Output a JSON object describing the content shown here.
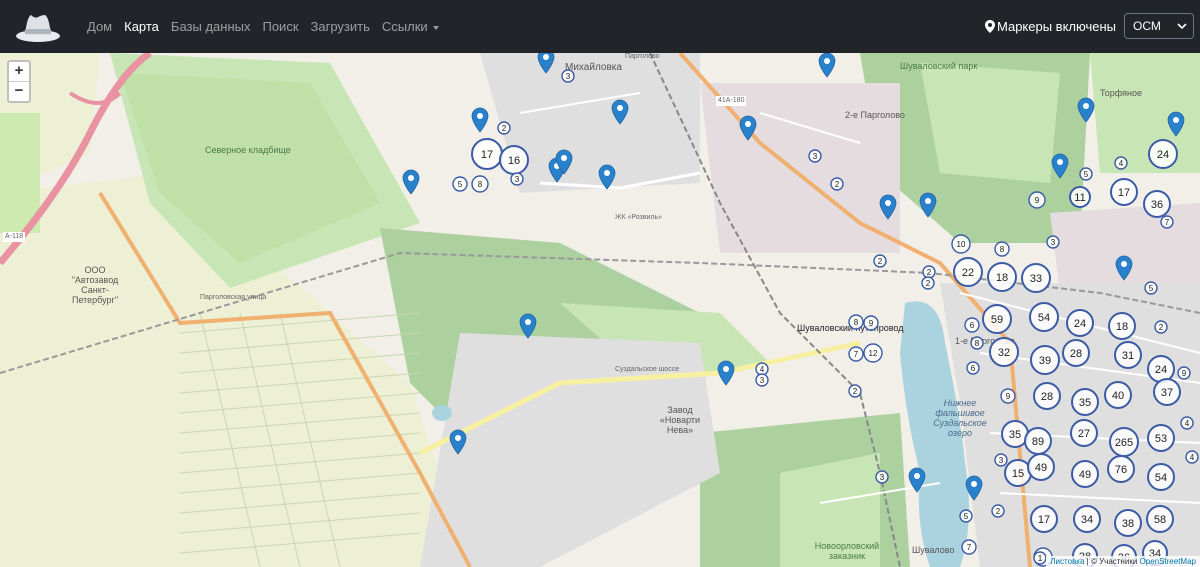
{
  "navbar": {
    "brand_icon": "spy-hat-icon",
    "links": [
      {
        "label": "Дом",
        "active": false
      },
      {
        "label": "Карта",
        "active": true
      },
      {
        "label": "Базы данных",
        "active": false
      },
      {
        "label": "Поиск",
        "active": false
      },
      {
        "label": "Загрузить",
        "active": false
      },
      {
        "label": "Ссылки",
        "active": false,
        "dropdown": true
      }
    ],
    "markers_label": "Маркеры включены",
    "layer_value": "ОСМ"
  },
  "map": {
    "zoom_in": "+",
    "zoom_out": "−",
    "attribution": {
      "leaflet": "Листовка",
      "sep": " | © Участники ",
      "osm": "OpenStreetMap"
    },
    "labels": {
      "cemetery": "Северное кладбище",
      "mikhailovka": "Михайловка",
      "pargolovo": "Парголово",
      "shuvalovsky_park": "Шуваловский парк",
      "torfyanoe": "Торфяное",
      "second_pargolovo": "2-е Парголово",
      "autozavod": "ООО \"Автозавод Санкт-Петербург\"",
      "shuvalovsky_overpass": "Шуваловский путепровод",
      "suzdalskoe": "Суздальское шоссе",
      "lower_lake": "Нижнее фальшивое Суздальское озеро",
      "novoorlovsky": "Новоорловский заказник",
      "pargolovskaya": "Парголовская улица",
      "a118": "А-118",
      "r41a180": "41А-180",
      "first_pargolovo": "1-е Парголово",
      "shuvalovo": "Шувалово",
      "novarti": "Завод «Новарти Нева»",
      "zk_rosvi": "ЖК «Розвиль»"
    },
    "markers": [
      "pin",
      "pin",
      "pin",
      "pin",
      "pin",
      "pin",
      "pin",
      "pin",
      "pin",
      "pin",
      "pin",
      "pin",
      "pin",
      "pin",
      "pin",
      "pin",
      "pin",
      "pin",
      "pin",
      "pin"
    ],
    "clusters": [
      {
        "n": "17"
      },
      {
        "n": "16"
      },
      {
        "n": "24"
      },
      {
        "n": "17"
      },
      {
        "n": "36"
      },
      {
        "n": "22"
      },
      {
        "n": "18"
      },
      {
        "n": "33"
      },
      {
        "n": "59"
      },
      {
        "n": "54"
      },
      {
        "n": "24"
      },
      {
        "n": "18"
      },
      {
        "n": "32"
      },
      {
        "n": "39"
      },
      {
        "n": "28"
      },
      {
        "n": "31"
      },
      {
        "n": "24"
      },
      {
        "n": "28"
      },
      {
        "n": "35"
      },
      {
        "n": "40"
      },
      {
        "n": "37"
      },
      {
        "n": "35"
      },
      {
        "n": "89"
      },
      {
        "n": "27"
      },
      {
        "n": "265"
      },
      {
        "n": "53"
      },
      {
        "n": "15"
      },
      {
        "n": "49"
      },
      {
        "n": "49"
      },
      {
        "n": "76"
      },
      {
        "n": "54"
      },
      {
        "n": "17"
      },
      {
        "n": "34"
      },
      {
        "n": "38"
      },
      {
        "n": "58"
      },
      {
        "n": "34"
      },
      {
        "n": "28"
      },
      {
        "n": "36"
      },
      {
        "n": "11"
      },
      {
        "n": "10"
      },
      {
        "n": "12"
      },
      {
        "n": "9"
      },
      {
        "n": "11"
      },
      {
        "n": "8"
      },
      {
        "n": "8"
      },
      {
        "n": "5"
      },
      {
        "n": "3"
      },
      {
        "n": "2"
      },
      {
        "n": "8"
      },
      {
        "n": "9"
      },
      {
        "n": "7"
      },
      {
        "n": "6"
      },
      {
        "n": "4"
      },
      {
        "n": "3"
      },
      {
        "n": "2"
      },
      {
        "n": "3"
      },
      {
        "n": "2"
      },
      {
        "n": "5"
      },
      {
        "n": "4"
      },
      {
        "n": "3"
      },
      {
        "n": "2"
      },
      {
        "n": "9"
      },
      {
        "n": "8"
      },
      {
        "n": "7"
      },
      {
        "n": "5"
      },
      {
        "n": "3"
      },
      {
        "n": "2"
      },
      {
        "n": "4"
      },
      {
        "n": "2"
      },
      {
        "n": "3"
      },
      {
        "n": "5"
      },
      {
        "n": "7"
      },
      {
        "n": "6"
      },
      {
        "n": "2"
      },
      {
        "n": "4"
      },
      {
        "n": "3"
      },
      {
        "n": "2"
      },
      {
        "n": "9"
      },
      {
        "n": "1"
      }
    ]
  },
  "colors": {
    "navbar_bg": "#212529",
    "marker_blue": "#2a81cb",
    "cluster_ring": "#3b5ba5",
    "park_green": "#c8e6b5",
    "forest": "#add19e",
    "water": "#aad3df",
    "motorway": "#e892a2",
    "primary": "#fcd6a4"
  }
}
